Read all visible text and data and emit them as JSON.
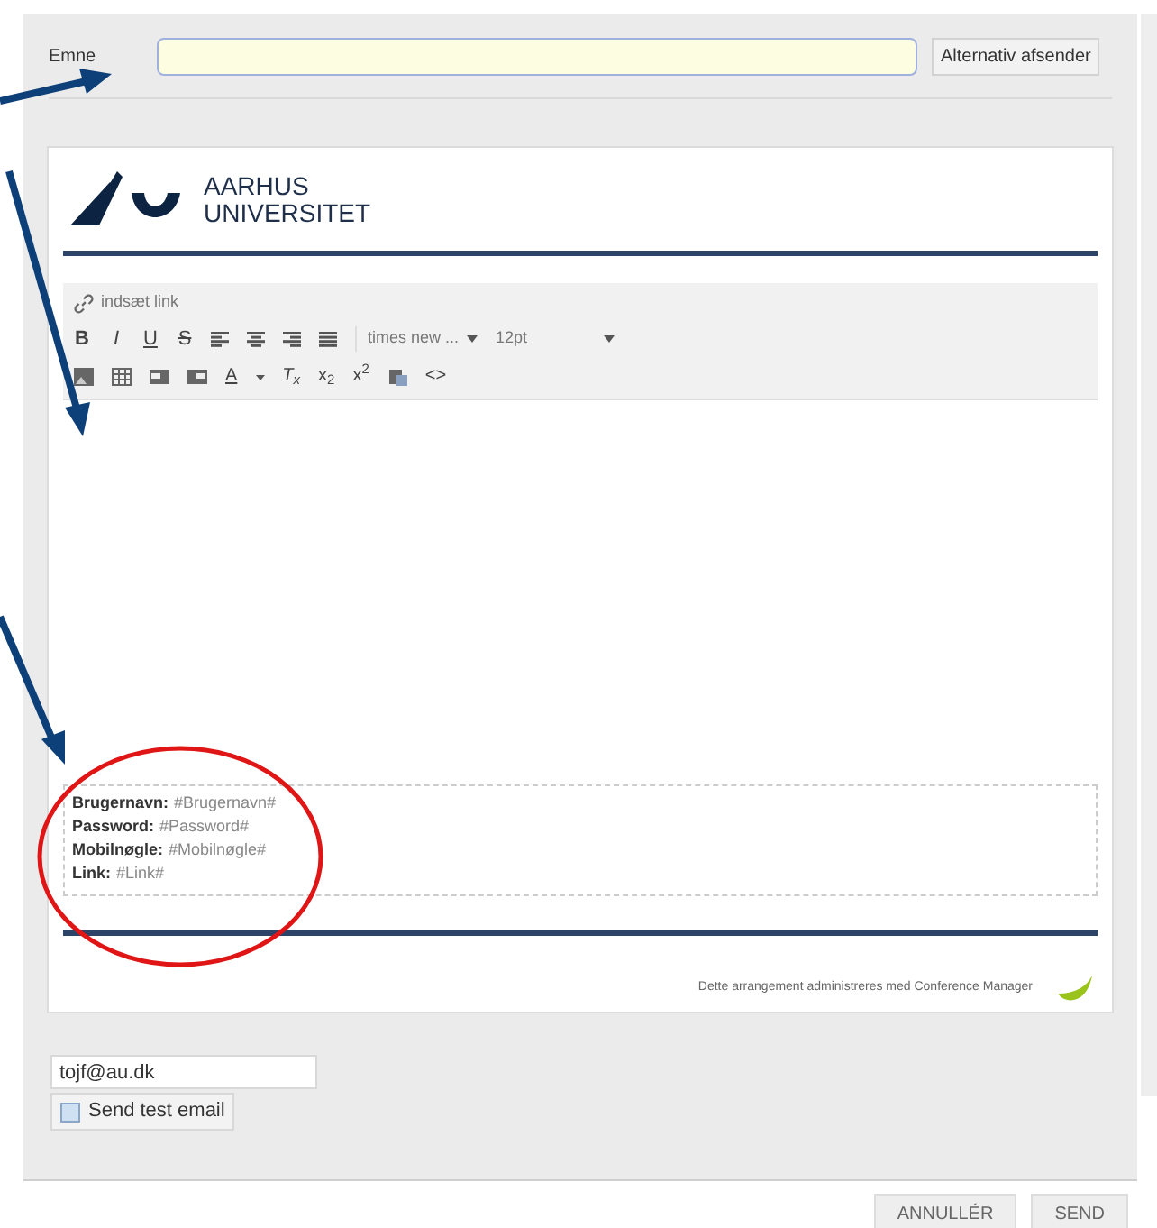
{
  "subject": {
    "label": "Emne"
  },
  "alt_sender_button": "Alternativ afsender",
  "logo": {
    "line_1": "AARHUS",
    "line_2": "UNIVERSITET"
  },
  "editor": {
    "insert_link": "indsæt link",
    "format_glyphs": [
      "B",
      "I",
      "U",
      "S"
    ],
    "font_select": "times new ...",
    "size_select": "12pt",
    "row_2_glyphs": [
      "A",
      "T$_{x}$",
      "x$_{2}$",
      "x$^{2}$",
      "<>"
    ]
  },
  "template_fields": [
    {
      "label": "Brugernavn:",
      "token": "#Brugernavn#"
    },
    {
      "label": "Password:",
      "token": "#Password#"
    },
    {
      "label": "Mobilnøgle:",
      "token": "#Mobilnøgle#"
    },
    {
      "label": "Link:",
      "token": "#Link#"
    }
  ],
  "footer_text": "Dette arrangement administreres med Conference Manager",
  "test_email": {
    "value": "tojf@au.dk",
    "button": "Send test email"
  },
  "actions": [
    "ANNULLÉR",
    "SEND"
  ]
}
